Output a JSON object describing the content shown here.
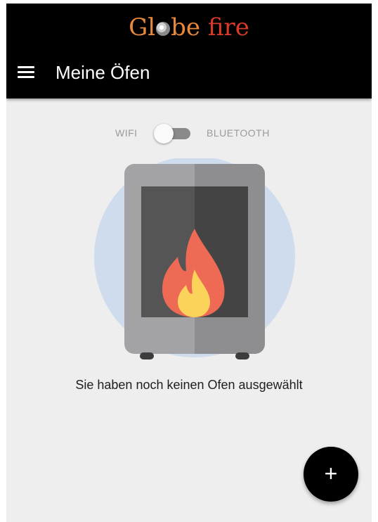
{
  "brand": {
    "part1": "Gl",
    "part2": "be",
    "part3": "fire"
  },
  "appbar": {
    "title": "Meine Öfen",
    "menu_icon": "hamburger-menu-icon"
  },
  "connection": {
    "left_label": "WIFI",
    "right_label": "BLUETOOTH",
    "selected": "WIFI"
  },
  "empty_state": {
    "illustration_icon": "stove-fire-icon",
    "message": "Sie haben noch keinen Ofen ausgewählt"
  },
  "fab": {
    "label": "+",
    "icon": "plus-icon"
  },
  "colors": {
    "appbar_bg": "#000000",
    "page_bg": "#eeeeee",
    "brand_orange": "#e98a3a",
    "brand_red": "#d93a2a",
    "circle_bg": "#cfdced"
  }
}
